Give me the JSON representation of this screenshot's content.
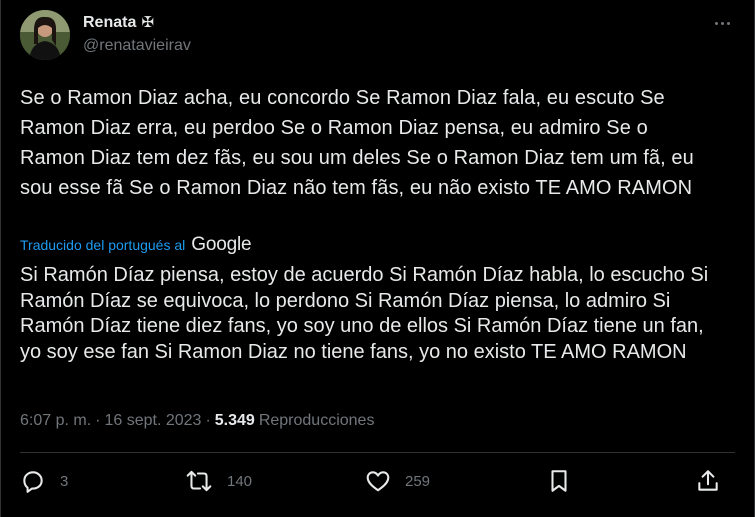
{
  "author": {
    "display_name": "Renata",
    "badge": "✠",
    "handle": "@renatavieirav"
  },
  "tweet": {
    "original_text": "Se o Ramon Diaz acha, eu concordo Se Ramon Diaz fala, eu escuto Se Ramon Diaz erra, eu perdoo Se o Ramon Diaz pensa, eu admiro Se o Ramon Diaz tem dez fãs, eu sou um deles Se o Ramon Diaz tem um fã, eu sou esse fã Se o Ramon Diaz não tem fãs, eu não existo TE AMO RAMON",
    "translated_label": "Traducido del portugués al",
    "translator_brand": "Google",
    "translated_text": "Si Ramón Díaz piensa, estoy de acuerdo Si Ramón Díaz habla, lo escucho Si Ramón Díaz se equivoca, lo perdono Si Ramón Díaz piensa, lo admiro Si Ramón Díaz tiene diez fans, yo soy uno de ellos Si Ramón Díaz tiene un fan, yo soy ese fan Si Ramon Diaz no tiene fans, yo no existo TE AMO RAMON",
    "time": "6:07 p. m.",
    "separator": "·",
    "date": "16 sept. 2023",
    "views_count": "5.349",
    "views_label": "Reproducciones"
  },
  "actions": {
    "replies": "3",
    "retweets": "140",
    "likes": "259"
  },
  "colors": {
    "background": "#000000",
    "text": "#e7e9ea",
    "muted": "#71767b",
    "link": "#1d9bf0",
    "border": "#2f3336"
  },
  "icons": [
    "more-icon",
    "reply-icon",
    "retweet-icon",
    "like-icon",
    "bookmark-icon",
    "share-icon"
  ]
}
